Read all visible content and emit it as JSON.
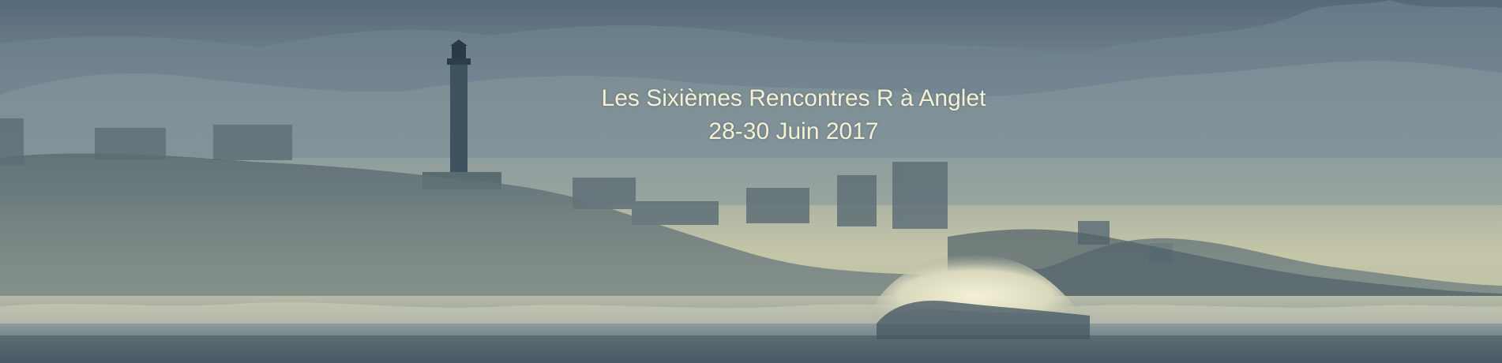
{
  "banner": {
    "title_line_1": "Les Sixièmes Rencontres R à Anglet",
    "title_line_2": "28-30 Juin 2017"
  },
  "colors": {
    "title_text": "#f3f0d4",
    "sky": "#7f8f95",
    "haze": "#c2c3a6",
    "sea": "#5e6f7a"
  }
}
